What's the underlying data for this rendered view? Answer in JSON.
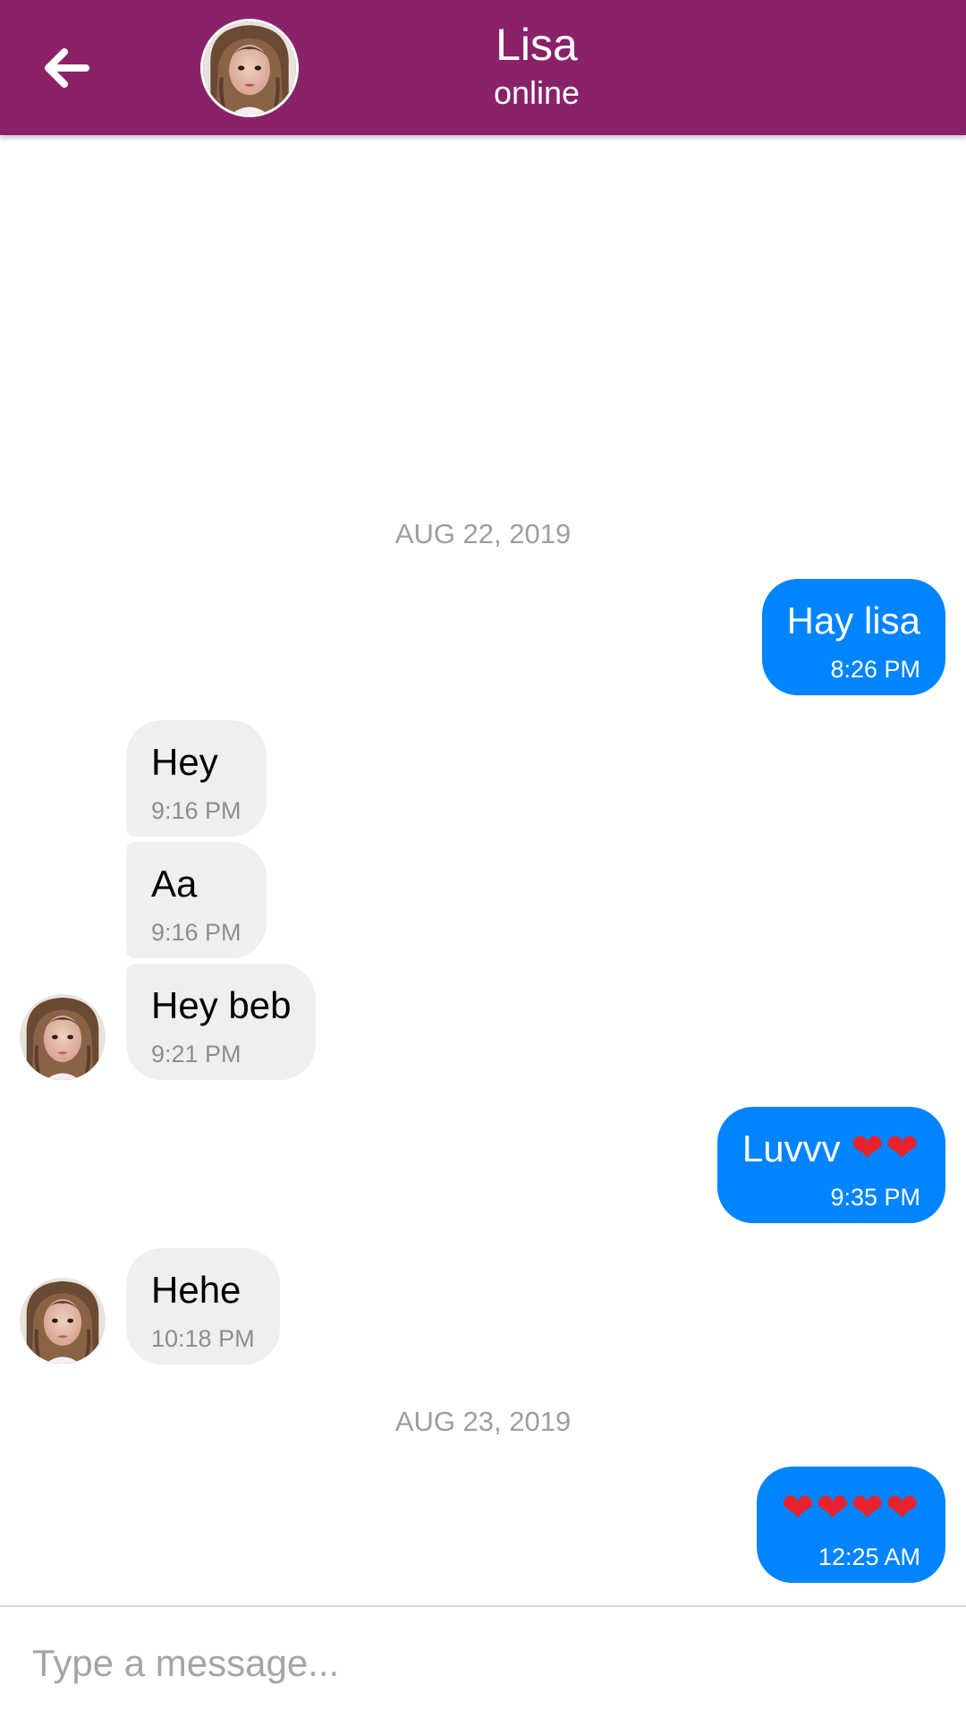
{
  "header": {
    "back_icon": "arrow-left-icon",
    "avatar": "contact-avatar",
    "title": "Lisa",
    "status": "online",
    "bg_color": "#8a2269"
  },
  "dates": [
    "AUG 22, 2019",
    "AUG 23, 2019"
  ],
  "messages": [
    {
      "dir": "out",
      "text": "Hay lisa",
      "time": "8:26 PM"
    },
    {
      "dir": "in",
      "text": "Hey",
      "time": "9:16 PM"
    },
    {
      "dir": "in",
      "text": "Aa",
      "time": "9:16 PM"
    },
    {
      "dir": "in",
      "text": "Hey beb",
      "time": "9:21 PM"
    },
    {
      "dir": "out",
      "text": "Luvvv",
      "emoji": "❤❤",
      "time": "9:35 PM"
    },
    {
      "dir": "in",
      "text": "Hehe",
      "time": "10:18 PM"
    },
    {
      "dir": "out",
      "text": "",
      "emoji": "❤❤❤❤",
      "time": "12:25 AM"
    }
  ],
  "composer": {
    "placeholder": "Type a message..."
  },
  "colors": {
    "outgoing": "#0084ff",
    "incoming": "#efefef",
    "date": "#9e9e9e"
  }
}
